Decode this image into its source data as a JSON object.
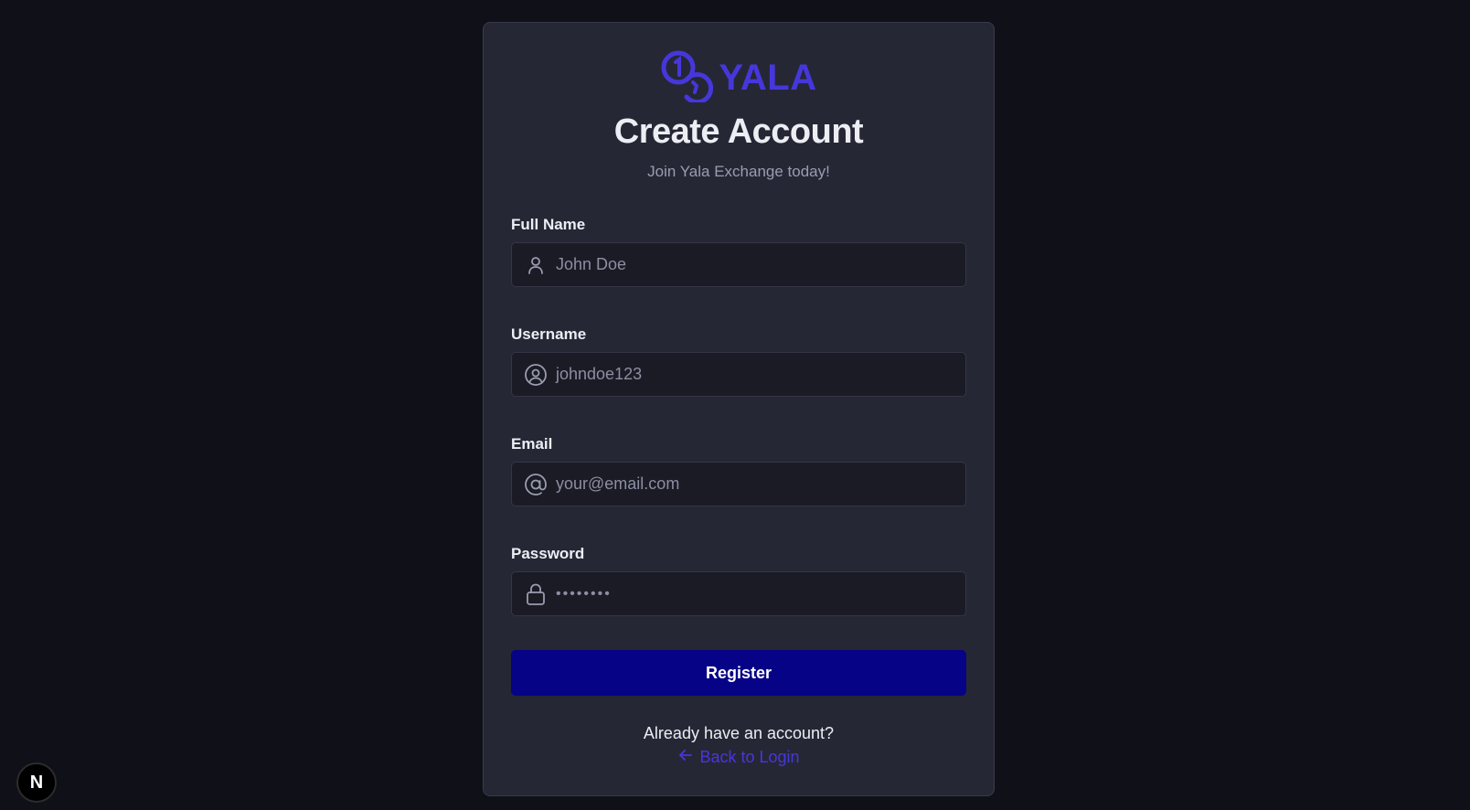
{
  "brand": {
    "name": "YALA",
    "logo_icon": "coins-icon",
    "color": "#4637dc"
  },
  "header": {
    "title": "Create Account",
    "subtitle": "Join Yala Exchange today!"
  },
  "form": {
    "full_name": {
      "label": "Full Name",
      "value": "John Doe",
      "icon": "user-icon"
    },
    "username": {
      "label": "Username",
      "value": "johndoe123",
      "icon": "user-circle-icon"
    },
    "email": {
      "label": "Email",
      "value": "your@email.com",
      "icon": "at-sign-icon"
    },
    "password": {
      "label": "Password",
      "value": "••••••••",
      "icon": "lock-icon"
    },
    "submit_label": "Register",
    "submit_color": "#060386"
  },
  "footer": {
    "prompt": "Already have an account?",
    "back_link_label": "Back to Login",
    "back_icon": "arrow-left-icon"
  },
  "dev_badge": {
    "letter": "N",
    "icon": "nextjs-icon"
  },
  "colors": {
    "background": "#0f1018",
    "card": "#262735",
    "input": "#1a1b24"
  }
}
